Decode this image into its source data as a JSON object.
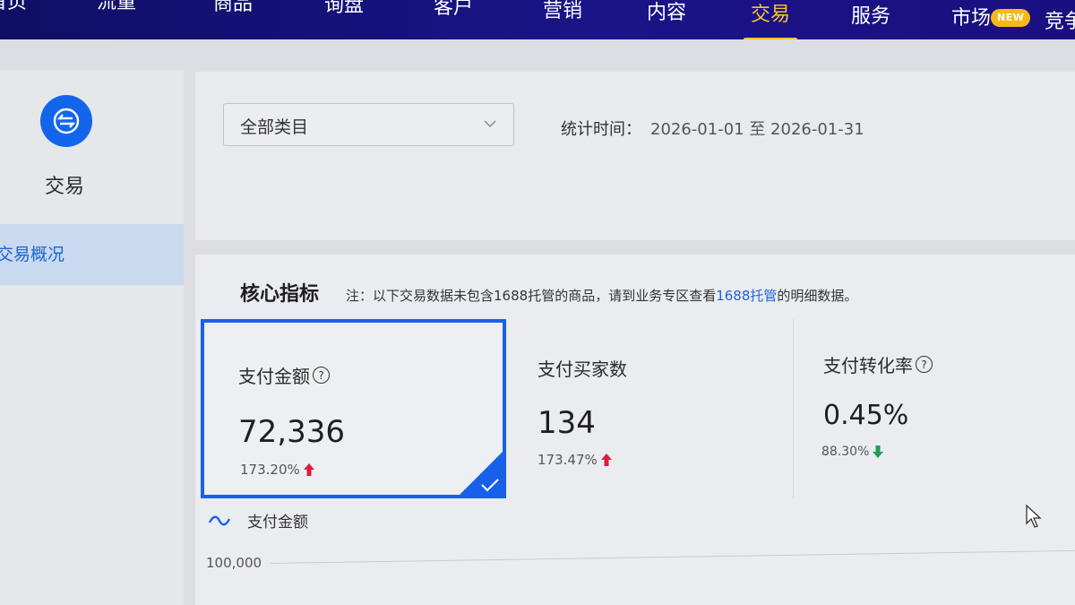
{
  "nav": {
    "items": [
      "首页",
      "流量",
      "商品",
      "询盘",
      "客户",
      "营销",
      "内容",
      "交易",
      "服务",
      "市场",
      "竞争"
    ],
    "active_index": 7,
    "badge": "NEW"
  },
  "sidebar": {
    "icon": "exchange-icon",
    "title": "交易",
    "items": [
      {
        "label": "交易概况",
        "active": true
      }
    ]
  },
  "filter": {
    "category_value": "全部类目",
    "stat_time_label": "统计时间：",
    "stat_time_range": "2026-01-01 至 2026-01-31"
  },
  "metrics": {
    "title": "核心指标",
    "note_prefix": "注：以下交易数据未包含1688托管的商品，请到业务专区查看",
    "note_link": "1688托管",
    "note_suffix": "的明细数据。",
    "cards": [
      {
        "label": "支付金额",
        "value": "72,336",
        "change": "173.20%",
        "direction": "up",
        "has_help": true,
        "selected": true
      },
      {
        "label": "支付买家数",
        "value": "134",
        "change": "173.47%",
        "direction": "up",
        "has_help": false,
        "selected": false
      },
      {
        "label": "支付转化率",
        "value": "0.45%",
        "change": "88.30%",
        "direction": "down",
        "has_help": true,
        "selected": false
      }
    ],
    "legend_label": "支付金额",
    "y_tick": "100,000"
  },
  "colors": {
    "nav_bg": "#1a1488",
    "active_nav": "#f7c433",
    "brand_blue": "#1761ea",
    "up_red": "#d81f3c",
    "down_green": "#1e9e58"
  }
}
